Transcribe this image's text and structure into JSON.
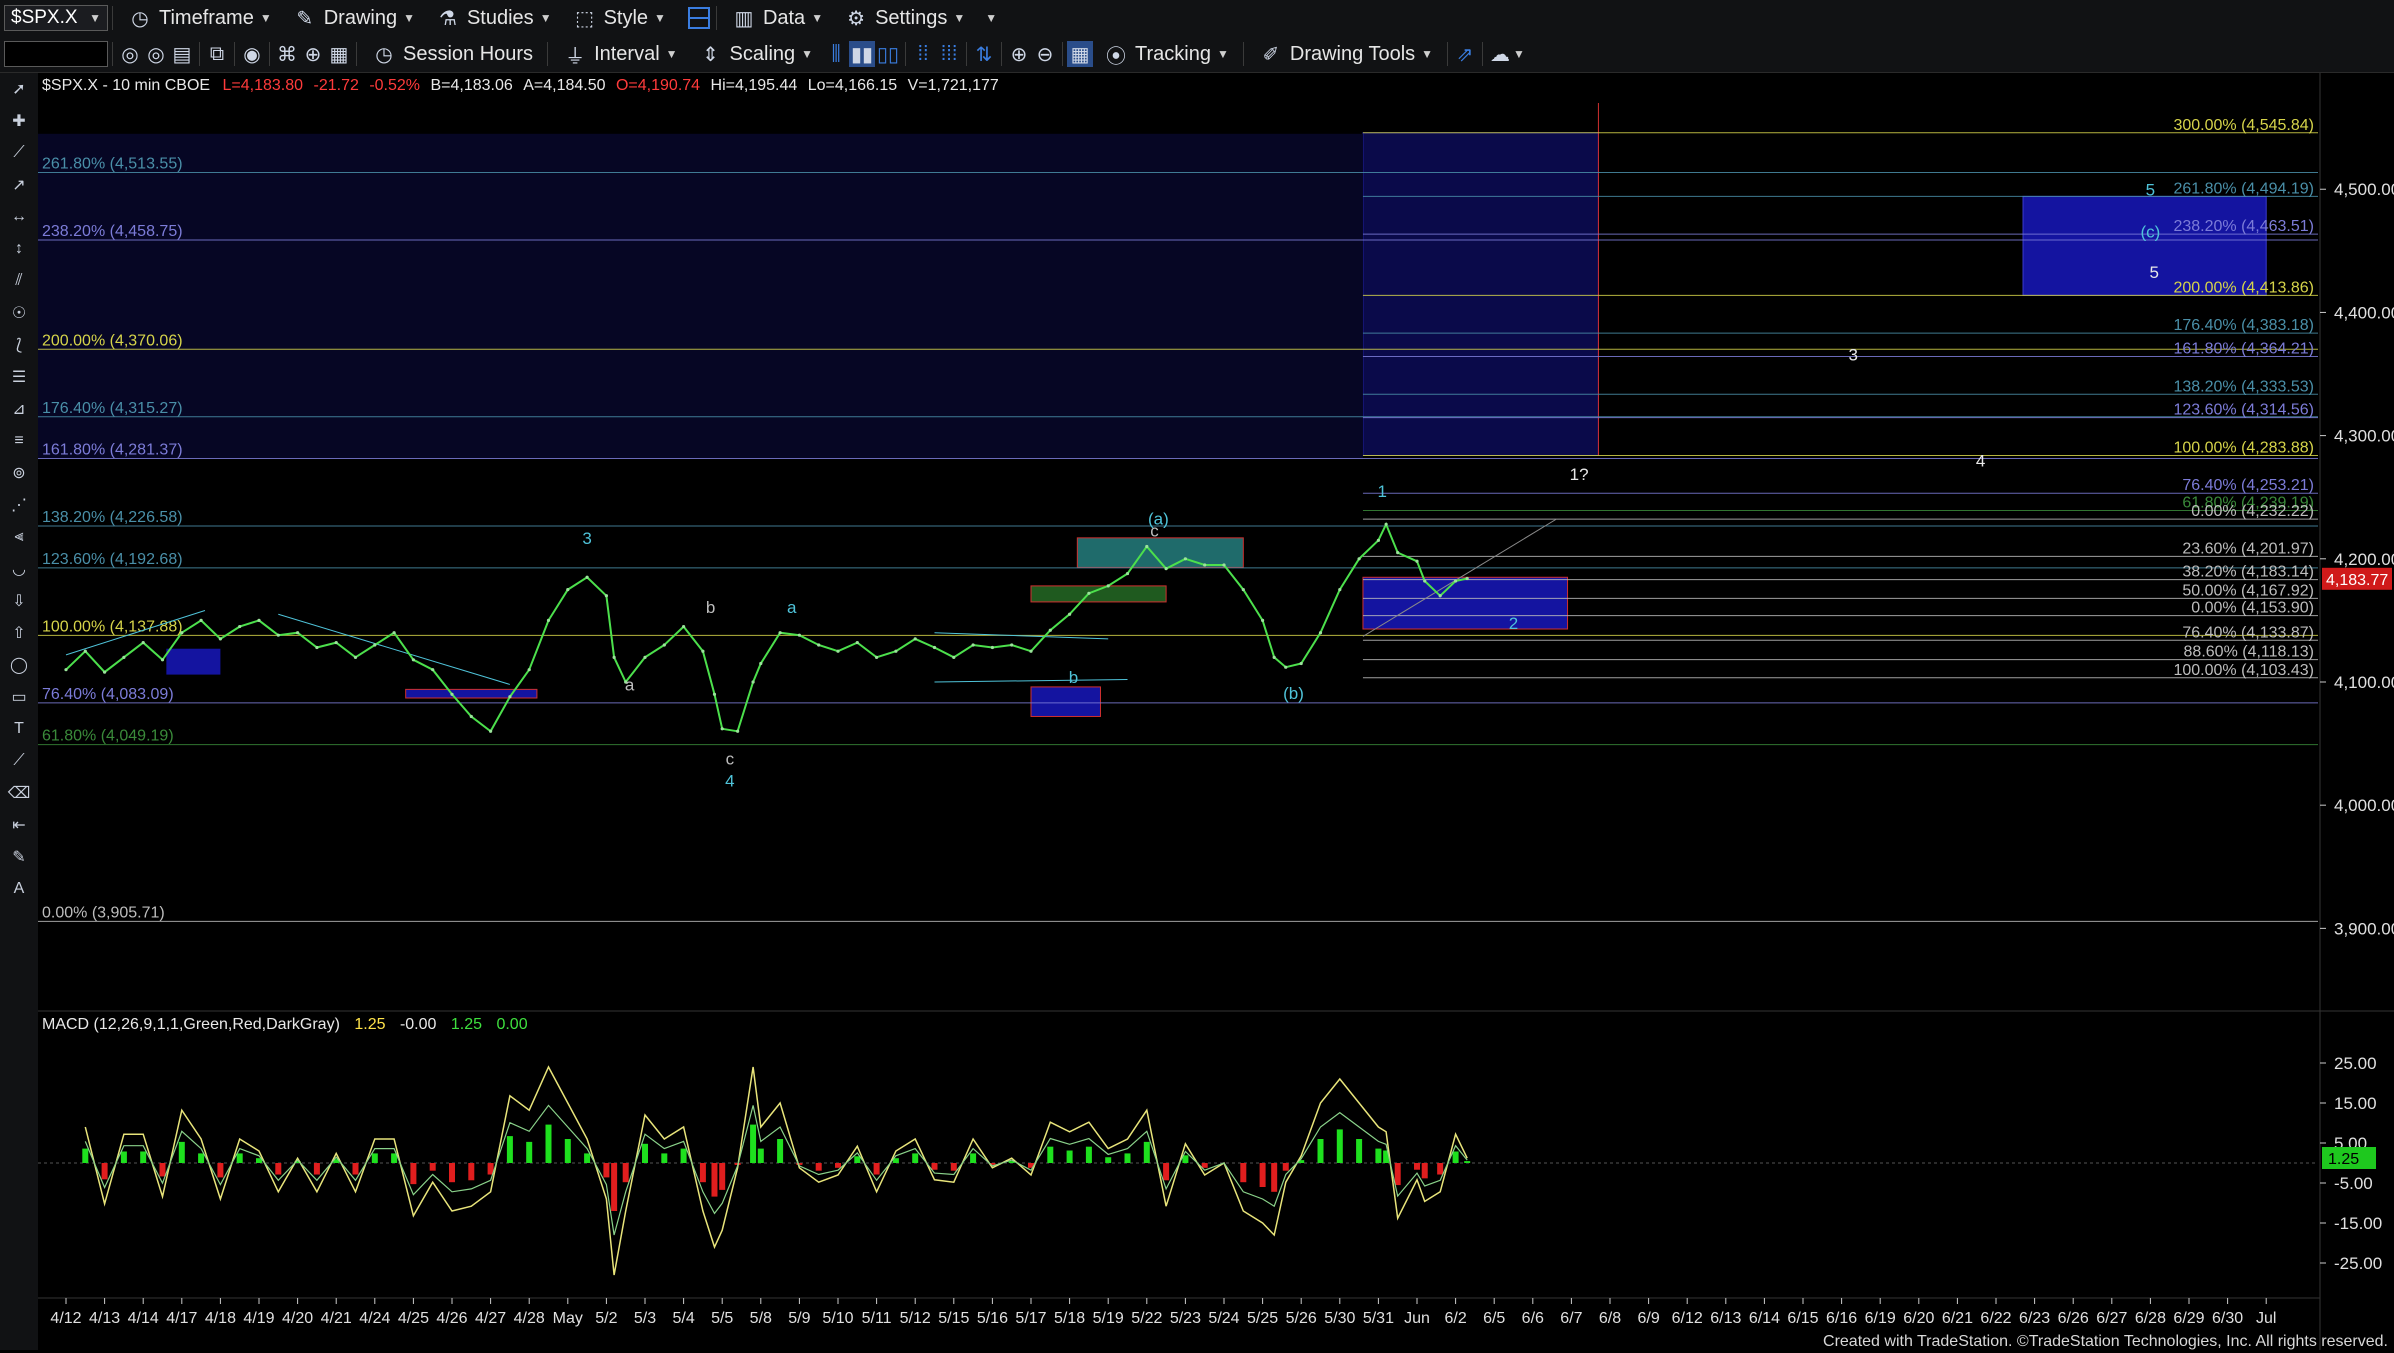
{
  "toolbar": {
    "symbol": "$SPX.X",
    "timeframe": "Timeframe",
    "drawing": "Drawing",
    "studies": "Studies",
    "style": "Style",
    "data": "Data",
    "settings": "Settings",
    "session_hours": "Session Hours",
    "interval": "Interval",
    "scaling": "Scaling",
    "tracking": "Tracking",
    "drawing_tools": "Drawing Tools"
  },
  "header": {
    "symbol": "$SPX.X - 10 min CBOE",
    "last": "L=4,183.80",
    "net": "-21.72",
    "pct": "-0.52%",
    "bid": "B=4,183.06",
    "ask": "A=4,184.50",
    "open": "O=4,190.74",
    "hi": "Hi=4,195.44",
    "lo": "Lo=4,166.15",
    "vol": "V=1,721,177"
  },
  "price_axis": {
    "ticks": [
      "4,500.00",
      "4,400.00",
      "4,300.00",
      "4,200.00",
      "4,100.00",
      "4,000.00",
      "3,900.00"
    ],
    "last_price_tag": "4,183.77"
  },
  "left_fibs": [
    {
      "label": "261.80% (4,513.55)",
      "price": 4513.55,
      "color": "#4a8fa8"
    },
    {
      "label": "238.20% (4,458.75)",
      "price": 4458.75,
      "color": "#7c7cd8"
    },
    {
      "label": "200.00% (4,370.06)",
      "price": 4370.06,
      "color": "#d6d44a"
    },
    {
      "label": "176.40% (4,315.27)",
      "price": 4315.27,
      "color": "#4a8fa8"
    },
    {
      "label": "161.80% (4,281.37)",
      "price": 4281.37,
      "color": "#7c7cd8"
    },
    {
      "label": "138.20% (4,226.58)",
      "price": 4226.58,
      "color": "#4a8fa8"
    },
    {
      "label": "123.60% (4,192.68)",
      "price": 4192.68,
      "color": "#4a8fa8"
    },
    {
      "label": "100.00% (4,137.88)",
      "price": 4137.88,
      "color": "#d6d44a"
    },
    {
      "label": "76.40% (4,083.09)",
      "price": 4083.09,
      "color": "#7c7cd8"
    },
    {
      "label": "61.80% (4,049.19)",
      "price": 4049.19,
      "color": "#3a8a3a"
    },
    {
      "label": "0.00% (3,905.71)",
      "price": 3905.71,
      "color": "#bdbdbd"
    }
  ],
  "right_fibs": [
    {
      "label": "300.00% (4,545.84)",
      "price": 4545.84,
      "color": "#d6d44a"
    },
    {
      "label": "261.80% (4,494.19)",
      "price": 4494.19,
      "color": "#4a8fa8"
    },
    {
      "label": "238.20% (4,463.51)",
      "price": 4463.51,
      "color": "#7c7cd8"
    },
    {
      "label": "200.00% (4,413.86)",
      "price": 4413.86,
      "color": "#d6d44a"
    },
    {
      "label": "176.40% (4,383.18)",
      "price": 4383.18,
      "color": "#4a8fa8"
    },
    {
      "label": "161.80% (4,364.21)",
      "price": 4364.21,
      "color": "#7c7cd8"
    },
    {
      "label": "138.20% (4,333.53)",
      "price": 4333.53,
      "color": "#4a8fa8"
    },
    {
      "label": "123.60% (4,314.56)",
      "price": 4314.56,
      "color": "#7c7cd8"
    },
    {
      "label": "100.00% (4,283.88)",
      "price": 4283.88,
      "color": "#d6d44a"
    },
    {
      "label": "76.40% (4,253.21)",
      "price": 4253.21,
      "color": "#7c7cd8"
    },
    {
      "label": "61.80% (4,239.19)",
      "price": 4239.19,
      "color": "#3a8a3a"
    },
    {
      "label": "0.00% (4,232.22)",
      "price": 4232.22,
      "color": "#bdbdbd"
    },
    {
      "label": "23.60% (4,201.97)",
      "price": 4201.97,
      "color": "#bdbdbd"
    },
    {
      "label": "38.20% (4,183.14)",
      "price": 4183.14,
      "color": "#bdbdbd"
    },
    {
      "label": "50.00% (4,167.92)",
      "price": 4167.92,
      "color": "#bdbdbd"
    },
    {
      "label": "0.00% (4,153.90)",
      "price": 4153.9,
      "color": "#bdbdbd"
    },
    {
      "label": "76.40% (4,133.87)",
      "price": 4133.87,
      "color": "#bdbdbd"
    },
    {
      "label": "88.60% (4,118.13)",
      "price": 4118.13,
      "color": "#bdbdbd"
    },
    {
      "label": "100.00% (4,103.43)",
      "price": 4103.43,
      "color": "#bdbdbd"
    }
  ],
  "wave_labels": [
    {
      "text": "3",
      "date_idx": 13.5,
      "price": 4212,
      "color": "#4fc3d9"
    },
    {
      "text": "a",
      "date_idx": 14.6,
      "price": 4093,
      "color": "#bdbdbd"
    },
    {
      "text": "b",
      "date_idx": 16.7,
      "price": 4156,
      "color": "#bdbdbd"
    },
    {
      "text": "c",
      "date_idx": 17.2,
      "price": 4033,
      "color": "#bdbdbd"
    },
    {
      "text": "4",
      "date_idx": 17.2,
      "price": 4015,
      "color": "#4fc3d9"
    },
    {
      "text": "a",
      "date_idx": 18.8,
      "price": 4156,
      "color": "#4fc3d9"
    },
    {
      "text": "b",
      "date_idx": 26.1,
      "price": 4099,
      "color": "#4fc3d9"
    },
    {
      "text": "(a)",
      "date_idx": 28.3,
      "price": 4228,
      "color": "#4fc3d9"
    },
    {
      "text": "c",
      "date_idx": 28.2,
      "price": 4218,
      "color": "#bdbdbd"
    },
    {
      "text": "(b)",
      "date_idx": 31.8,
      "price": 4086,
      "color": "#4fc3d9"
    },
    {
      "text": "1",
      "date_idx": 34.1,
      "price": 4250,
      "color": "#4fc3d9"
    },
    {
      "text": "2",
      "date_idx": 37.5,
      "price": 4143,
      "color": "#4fc3d9"
    },
    {
      "text": "1?",
      "date_idx": 39.2,
      "price": 4264,
      "color": "#e8e8e8"
    },
    {
      "text": "3",
      "date_idx": 46.3,
      "price": 4361,
      "color": "#e8e8e8"
    },
    {
      "text": "4",
      "date_idx": 49.6,
      "price": 4275,
      "color": "#e8e8e8"
    },
    {
      "text": "5",
      "date_idx": 54.0,
      "price": 4495,
      "color": "#4fc3d9"
    },
    {
      "text": "(c)",
      "date_idx": 54.0,
      "price": 4461,
      "color": "#4fc3d9"
    },
    {
      "text": "5",
      "date_idx": 54.1,
      "price": 4428,
      "color": "#e8e8e8"
    }
  ],
  "x_axis": {
    "ticks": [
      "4/12",
      "4/13",
      "4/14",
      "4/17",
      "4/18",
      "4/19",
      "4/20",
      "4/21",
      "4/24",
      "4/25",
      "4/26",
      "4/27",
      "4/28",
      "May",
      "5/2",
      "5/3",
      "5/4",
      "5/5",
      "5/8",
      "5/9",
      "5/10",
      "5/11",
      "5/12",
      "5/15",
      "5/16",
      "5/17",
      "5/18",
      "5/19",
      "5/22",
      "5/23",
      "5/24",
      "5/25",
      "5/26",
      "5/30",
      "5/31",
      "Jun",
      "6/2",
      "6/5",
      "6/6",
      "6/7",
      "6/8",
      "6/9",
      "6/12",
      "6/13",
      "6/14",
      "6/15",
      "6/16",
      "6/19",
      "6/20",
      "6/21",
      "6/22",
      "6/23",
      "6/26",
      "6/27",
      "6/28",
      "6/29",
      "6/30",
      "Jul"
    ]
  },
  "macd": {
    "title": "MACD (12,26,9,1,1,Green,Red,DarkGray)",
    "v1": "1.25",
    "v2": "-0.00",
    "v3": "1.25",
    "v4": "0.00",
    "ticks": [
      "25.00",
      "15.00",
      "5.00",
      "-5.00",
      "-15.00",
      "-25.00"
    ],
    "value_tag": "1.25"
  },
  "footer": "Created with TradeStation. ©TradeStation Technologies, Inc. All rights reserved.",
  "chart_data": {
    "type": "line",
    "series": [
      {
        "name": "$SPX.X",
        "values": [
          [
            0,
            4110
          ],
          [
            0.5,
            4125
          ],
          [
            1,
            4108
          ],
          [
            1.5,
            4120
          ],
          [
            2,
            4132
          ],
          [
            2.5,
            4118
          ],
          [
            3,
            4140
          ],
          [
            3.5,
            4150
          ],
          [
            4,
            4135
          ],
          [
            4.5,
            4145
          ],
          [
            5,
            4150
          ],
          [
            5.5,
            4138
          ],
          [
            6,
            4140
          ],
          [
            6.5,
            4128
          ],
          [
            7,
            4132
          ],
          [
            7.5,
            4120
          ],
          [
            8,
            4130
          ],
          [
            8.5,
            4140
          ],
          [
            9,
            4118
          ],
          [
            9.5,
            4110
          ],
          [
            10,
            4090
          ],
          [
            10.5,
            4072
          ],
          [
            11,
            4060
          ],
          [
            11.5,
            4088
          ],
          [
            12,
            4110
          ],
          [
            12.5,
            4150
          ],
          [
            13,
            4175
          ],
          [
            13.5,
            4185
          ],
          [
            14,
            4170
          ],
          [
            14.2,
            4120
          ],
          [
            14.5,
            4100
          ],
          [
            15,
            4120
          ],
          [
            15.5,
            4130
          ],
          [
            16,
            4145
          ],
          [
            16.5,
            4125
          ],
          [
            16.8,
            4090
          ],
          [
            17,
            4062
          ],
          [
            17.4,
            4060
          ],
          [
            17.8,
            4100
          ],
          [
            18,
            4115
          ],
          [
            18.5,
            4140
          ],
          [
            19,
            4138
          ],
          [
            19.5,
            4130
          ],
          [
            20,
            4125
          ],
          [
            20.5,
            4132
          ],
          [
            21,
            4120
          ],
          [
            21.5,
            4125
          ],
          [
            22,
            4135
          ],
          [
            22.5,
            4128
          ],
          [
            23,
            4120
          ],
          [
            23.5,
            4130
          ],
          [
            24,
            4128
          ],
          [
            24.5,
            4130
          ],
          [
            25,
            4125
          ],
          [
            25.5,
            4142
          ],
          [
            26,
            4155
          ],
          [
            26.5,
            4172
          ],
          [
            27,
            4178
          ],
          [
            27.5,
            4188
          ],
          [
            28,
            4210
          ],
          [
            28.5,
            4192
          ],
          [
            29,
            4200
          ],
          [
            29.5,
            4195
          ],
          [
            30,
            4195
          ],
          [
            30.5,
            4175
          ],
          [
            31,
            4150
          ],
          [
            31.3,
            4120
          ],
          [
            31.6,
            4112
          ],
          [
            32,
            4115
          ],
          [
            32.5,
            4140
          ],
          [
            33,
            4175
          ],
          [
            33.5,
            4200
          ],
          [
            34,
            4215
          ],
          [
            34.2,
            4228
          ],
          [
            34.5,
            4205
          ],
          [
            35,
            4198
          ],
          [
            35.2,
            4182
          ],
          [
            35.6,
            4170
          ],
          [
            36,
            4182
          ],
          [
            36.3,
            4184
          ]
        ]
      }
    ],
    "ylim": [
      3880,
      4570
    ]
  }
}
